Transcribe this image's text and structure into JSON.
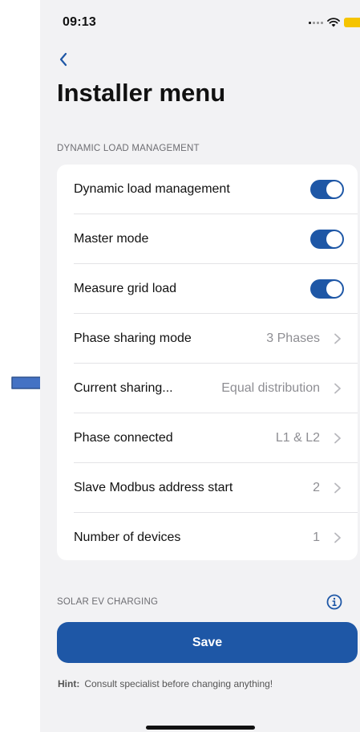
{
  "status_bar": {
    "time": "09:13"
  },
  "nav": {
    "back_icon": "chevron-left-icon"
  },
  "page": {
    "title": "Installer menu"
  },
  "sections": {
    "dlm_header": "DYNAMIC LOAD MANAGEMENT",
    "solar_header": "SOLAR EV CHARGING"
  },
  "rows": [
    {
      "label": "Dynamic load management",
      "type": "toggle",
      "on": true
    },
    {
      "label": "Master mode",
      "type": "toggle",
      "on": true
    },
    {
      "label": "Measure grid load",
      "type": "toggle",
      "on": true
    },
    {
      "label": "Phase sharing mode",
      "type": "disclosure",
      "value": "3 Phases"
    },
    {
      "label": "Current sharing...",
      "type": "disclosure",
      "value": "Equal distribution"
    },
    {
      "label": "Phase connected",
      "type": "disclosure",
      "value": "L1 & L2"
    },
    {
      "label": "Slave Modbus address start",
      "type": "disclosure",
      "value": "2"
    },
    {
      "label": "Number of devices",
      "type": "disclosure",
      "value": "1"
    }
  ],
  "save": {
    "label": "Save"
  },
  "hint": {
    "label": "Hint:",
    "text": "Consult specialist before changing anything!"
  },
  "colors": {
    "accent": "#1e57a6",
    "background": "#f2f2f4",
    "card": "#ffffff",
    "secondary_text": "#8e8e93",
    "battery": "#f5c400",
    "callout_arrow": "#4472c4"
  }
}
